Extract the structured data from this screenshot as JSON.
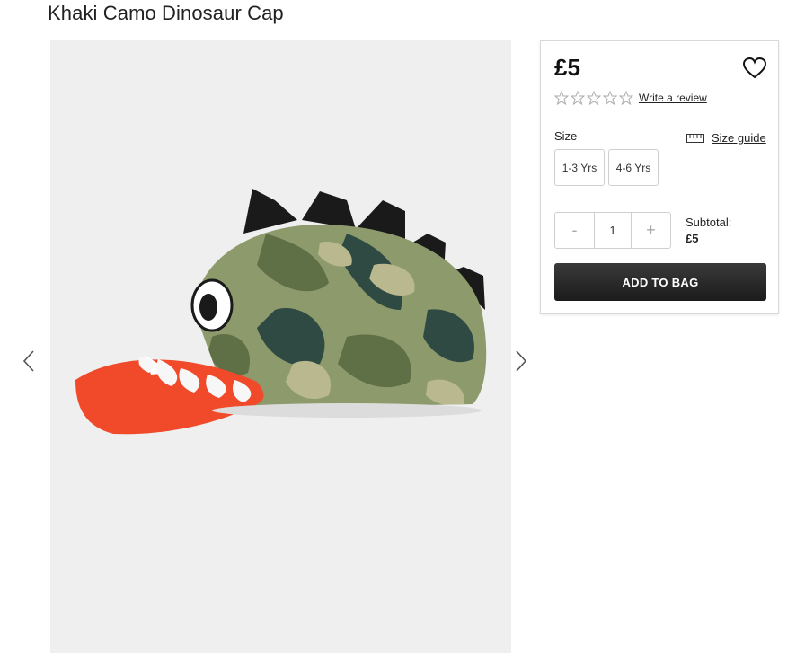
{
  "product": {
    "title": "Khaki Camo Dinosaur Cap",
    "price": "£5",
    "rating_stars": 5,
    "write_review_label": "Write a review"
  },
  "size": {
    "label": "Size",
    "guide_label": "Size guide",
    "options": [
      "1-3 Yrs",
      "4-6 Yrs"
    ]
  },
  "quantity": {
    "minus_label": "-",
    "value": "1",
    "plus_label": "+"
  },
  "subtotal": {
    "label": "Subtotal:",
    "value": "£5"
  },
  "actions": {
    "add_to_bag_label": "ADD TO BAG"
  },
  "gallery": {
    "prev_icon": "chevron-left-icon",
    "next_icon": "chevron-right-icon"
  },
  "colors": {
    "camo_light": "#8d9a6c",
    "camo_mid": "#5f6f46",
    "camo_dark": "#2f4a43",
    "brim": "#f04a2a",
    "button_bg": "#222222"
  }
}
